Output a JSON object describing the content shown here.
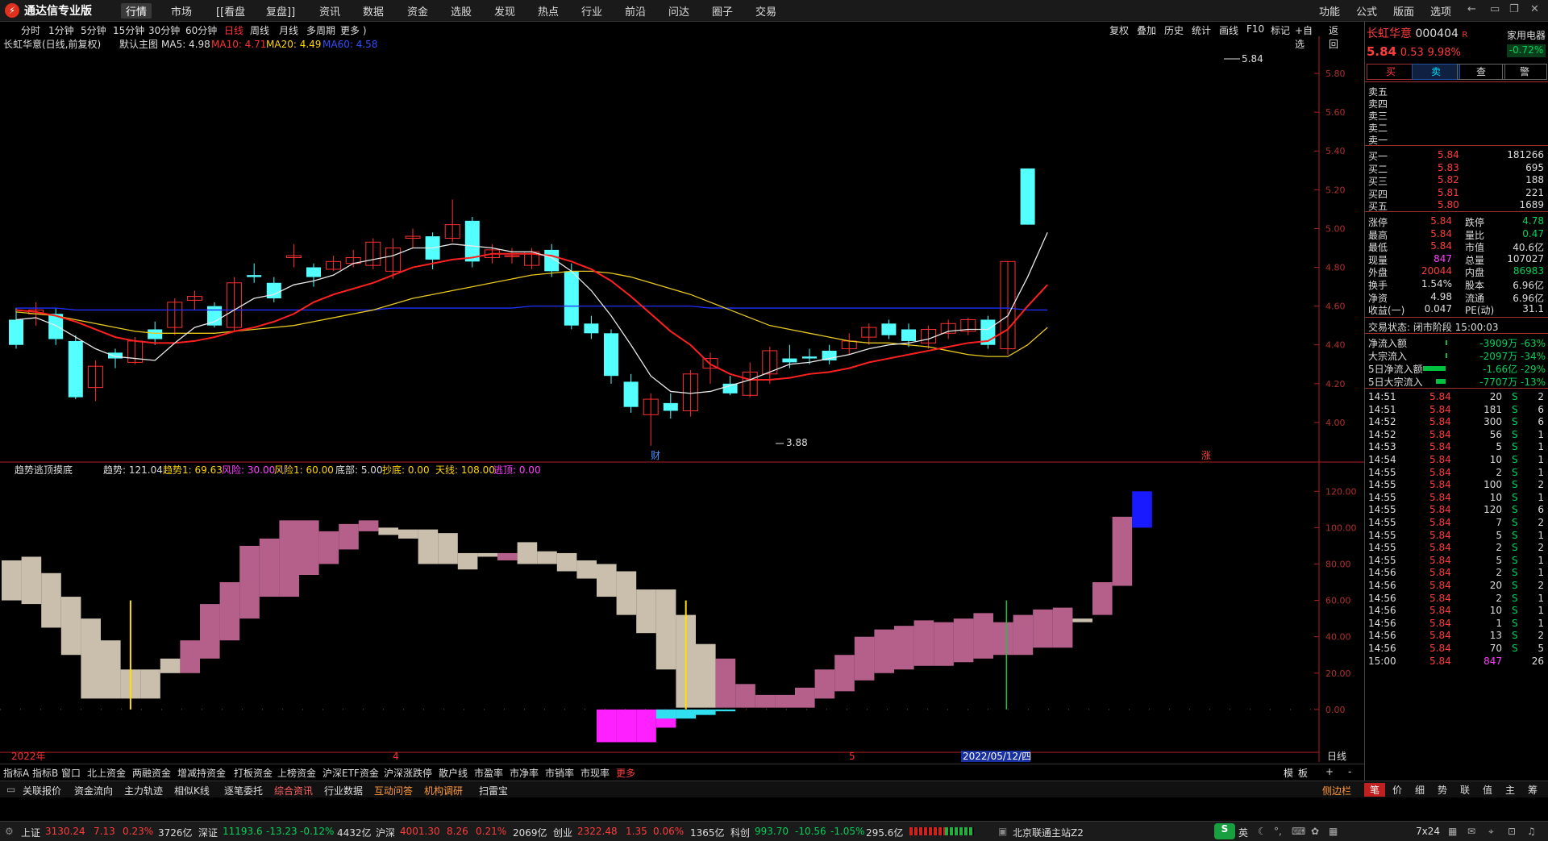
{
  "app": {
    "title": "通达信专业版",
    "logo_icon": "tdx-logo-icon"
  },
  "menu": [
    "行情",
    "市场",
    "[[看盘",
    "复盘]]",
    "资讯",
    "数据",
    "资金",
    "选股",
    "发现",
    "热点",
    "行业",
    "前沿",
    "问达",
    "圈子",
    "交易"
  ],
  "menu_right": [
    "功能",
    "公式",
    "版面",
    "选项"
  ],
  "periods": [
    "分时",
    "1分钟",
    "5分钟",
    "15分钟",
    "30分钟",
    "60分钟",
    "日线",
    "周线",
    "月线",
    "多周期",
    "更多 )"
  ],
  "active_period": "日线",
  "tools": [
    "复权",
    "叠加",
    "历史",
    "统计",
    "画线",
    "F10",
    "标记",
    "+自选",
    "返回"
  ],
  "main_chart": {
    "title": "长虹华意(日线,前复权)",
    "main_label": "默认主图",
    "ma5": "MA5: 4.98",
    "ma10": "MA10: 4.71",
    "ma20": "MA20: 4.49",
    "ma60": "MA60: 4.58",
    "high_mark": "5.84",
    "low_mark": "3.88",
    "cai_mark": "财",
    "zhang_mark": "涨"
  },
  "sub_chart": {
    "name": "趋势逃顶摸底",
    "trend": "趋势: 121.04",
    "trend1": "趋势1: 69.63",
    "risk": "风险: 30.00",
    "risk1": "风险1: 60.00",
    "bottom": "底部: 5.00",
    "buy_bottom": "抄底: 0.00",
    "sky": "天线: 108.00",
    "escape": "逃顶: 0.00"
  },
  "x_labels": [
    "2022年",
    "4",
    "5",
    "2022/05/12/四"
  ],
  "chart_data": [
    {
      "type": "candlestick",
      "y_ticks": [
        5.8,
        5.6,
        5.4,
        5.2,
        5.0,
        4.8,
        4.6,
        4.4,
        4.2,
        4.0
      ],
      "ylim": [
        3.85,
        5.9
      ],
      "candles": [
        [
          4.53,
          4.4,
          4.59,
          4.38
        ],
        [
          4.56,
          4.58,
          4.62,
          4.5
        ],
        [
          4.56,
          4.43,
          4.59,
          4.4
        ],
        [
          4.42,
          4.13,
          4.45,
          4.12
        ],
        [
          4.18,
          4.29,
          4.32,
          4.11
        ],
        [
          4.36,
          4.33,
          4.38,
          4.28
        ],
        [
          4.31,
          4.42,
          4.44,
          4.3
        ],
        [
          4.48,
          4.43,
          4.52,
          4.4
        ],
        [
          4.49,
          4.62,
          4.64,
          4.45
        ],
        [
          4.63,
          4.65,
          4.68,
          4.58
        ],
        [
          4.6,
          4.5,
          4.62,
          4.49
        ],
        [
          4.49,
          4.72,
          4.75,
          4.47
        ],
        [
          4.76,
          4.75,
          4.82,
          4.72
        ],
        [
          4.72,
          4.64,
          4.75,
          4.62
        ],
        [
          4.85,
          4.86,
          4.92,
          4.8
        ],
        [
          4.8,
          4.75,
          4.82,
          4.7
        ],
        [
          4.79,
          4.83,
          4.86,
          4.78
        ],
        [
          4.82,
          4.85,
          4.89,
          4.8
        ],
        [
          4.81,
          4.93,
          4.95,
          4.79
        ],
        [
          4.78,
          4.9,
          4.95,
          4.74
        ],
        [
          4.95,
          4.96,
          5.0,
          4.9
        ],
        [
          4.96,
          4.84,
          4.98,
          4.79
        ],
        [
          4.95,
          5.02,
          5.15,
          4.93
        ],
        [
          5.04,
          4.83,
          5.06,
          4.8
        ],
        [
          4.85,
          4.89,
          4.92,
          4.82
        ],
        [
          4.86,
          4.86,
          4.9,
          4.82
        ],
        [
          4.81,
          4.88,
          4.9,
          4.79
        ],
        [
          4.89,
          4.78,
          4.92,
          4.75
        ],
        [
          4.78,
          4.5,
          4.82,
          4.48
        ],
        [
          4.51,
          4.46,
          4.55,
          4.43
        ],
        [
          4.46,
          4.24,
          4.48,
          4.2
        ],
        [
          4.21,
          4.08,
          4.25,
          4.05
        ],
        [
          4.04,
          4.12,
          4.15,
          3.88
        ],
        [
          4.1,
          4.06,
          4.15,
          4.02
        ],
        [
          4.06,
          4.25,
          4.27,
          4.03
        ],
        [
          4.28,
          4.33,
          4.36,
          4.2
        ],
        [
          4.2,
          4.15,
          4.24,
          4.14
        ],
        [
          4.14,
          4.26,
          4.31,
          4.13
        ],
        [
          4.25,
          4.37,
          4.39,
          4.2
        ],
        [
          4.33,
          4.31,
          4.4,
          4.28
        ],
        [
          4.34,
          4.33,
          4.38,
          4.3
        ],
        [
          4.37,
          4.32,
          4.4,
          4.3
        ],
        [
          4.38,
          4.42,
          4.46,
          4.35
        ],
        [
          4.44,
          4.49,
          4.51,
          4.4
        ],
        [
          4.51,
          4.45,
          4.53,
          4.43
        ],
        [
          4.48,
          4.42,
          4.51,
          4.39
        ],
        [
          4.41,
          4.48,
          4.5,
          4.38
        ],
        [
          4.46,
          4.51,
          4.53,
          4.43
        ],
        [
          4.47,
          4.53,
          4.54,
          4.45
        ],
        [
          4.53,
          4.4,
          4.55,
          4.38
        ],
        [
          4.38,
          4.83,
          4.83,
          4.35
        ],
        [
          5.31,
          5.02,
          5.31,
          5.02
        ]
      ],
      "ma5": [
        4.53,
        4.54,
        4.5,
        4.44,
        4.38,
        4.34,
        4.33,
        4.32,
        4.41,
        4.49,
        4.52,
        4.58,
        4.64,
        4.66,
        4.71,
        4.73,
        4.76,
        4.82,
        4.84,
        4.86,
        4.9,
        4.9,
        4.92,
        4.91,
        4.9,
        4.88,
        4.88,
        4.85,
        4.78,
        4.68,
        4.55,
        4.4,
        4.24,
        4.16,
        4.15,
        4.16,
        4.19,
        4.22,
        4.26,
        4.3,
        4.31,
        4.33,
        4.35,
        4.38,
        4.4,
        4.41,
        4.43,
        4.47,
        4.48,
        4.48,
        4.55,
        4.75,
        4.98
      ],
      "ma10": [
        4.58,
        4.57,
        4.55,
        4.52,
        4.48,
        4.44,
        4.42,
        4.41,
        4.41,
        4.42,
        4.44,
        4.47,
        4.49,
        4.52,
        4.56,
        4.62,
        4.66,
        4.69,
        4.72,
        4.76,
        4.8,
        4.82,
        4.84,
        4.85,
        4.87,
        4.87,
        4.87,
        4.86,
        4.83,
        4.79,
        4.73,
        4.65,
        4.56,
        4.47,
        4.4,
        4.3,
        4.25,
        4.22,
        4.22,
        4.23,
        4.25,
        4.26,
        4.28,
        4.31,
        4.33,
        4.35,
        4.37,
        4.39,
        4.41,
        4.42,
        4.48,
        4.6,
        4.71
      ],
      "ma20": [
        4.57,
        4.56,
        4.55,
        4.53,
        4.51,
        4.49,
        4.47,
        4.46,
        4.46,
        4.46,
        4.46,
        4.47,
        4.48,
        4.49,
        4.5,
        4.52,
        4.54,
        4.56,
        4.58,
        4.61,
        4.64,
        4.66,
        4.68,
        4.7,
        4.72,
        4.74,
        4.76,
        4.77,
        4.78,
        4.78,
        4.77,
        4.75,
        4.72,
        4.69,
        4.66,
        4.62,
        4.58,
        4.54,
        4.5,
        4.48,
        4.46,
        4.44,
        4.42,
        4.41,
        4.41,
        4.4,
        4.39,
        4.37,
        4.35,
        4.34,
        4.34,
        4.4,
        4.49
      ],
      "ma60": [
        4.59,
        4.59,
        4.59,
        4.58,
        4.58,
        4.58,
        4.58,
        4.58,
        4.58,
        4.58,
        4.58,
        4.58,
        4.58,
        4.58,
        4.58,
        4.58,
        4.58,
        4.58,
        4.58,
        4.59,
        4.59,
        4.59,
        4.59,
        4.59,
        4.59,
        4.59,
        4.6,
        4.6,
        4.6,
        4.6,
        4.6,
        4.6,
        4.6,
        4.6,
        4.6,
        4.59,
        4.59,
        4.59,
        4.59,
        4.59,
        4.59,
        4.59,
        4.59,
        4.59,
        4.59,
        4.59,
        4.59,
        4.59,
        4.59,
        4.59,
        4.59,
        4.58,
        4.58
      ]
    },
    {
      "type": "bar",
      "y_ticks": [
        120.0,
        100.0,
        80.0,
        60.0,
        40.0,
        20.0,
        0.0
      ],
      "ylim": [
        -20,
        125
      ],
      "trend_bands": [
        [
          60,
          82
        ],
        [
          58,
          84
        ],
        [
          45,
          75
        ],
        [
          30,
          62
        ],
        [
          6,
          50
        ],
        [
          6,
          38
        ],
        [
          6,
          22
        ],
        [
          6,
          22
        ],
        [
          20,
          28
        ],
        [
          20,
          38
        ],
        [
          28,
          58
        ],
        [
          38,
          70
        ],
        [
          50,
          90
        ],
        [
          62,
          94
        ],
        [
          62,
          104
        ],
        [
          74,
          104
        ],
        [
          80,
          98
        ],
        [
          88,
          102
        ],
        [
          98,
          104
        ],
        [
          96,
          100
        ],
        [
          94,
          99
        ],
        [
          80,
          99
        ],
        [
          80,
          97
        ],
        [
          77,
          86
        ],
        [
          84,
          86
        ],
        [
          82,
          86
        ],
        [
          80,
          92
        ],
        [
          80,
          87
        ],
        [
          76,
          86
        ],
        [
          72,
          82
        ],
        [
          62,
          80
        ],
        [
          52,
          76
        ],
        [
          42,
          66
        ],
        [
          22,
          66
        ],
        [
          1,
          52
        ],
        [
          1,
          36
        ],
        [
          1,
          28
        ],
        [
          1,
          14
        ],
        [
          1,
          8
        ],
        [
          1,
          8
        ],
        [
          1,
          12
        ],
        [
          6,
          22
        ],
        [
          10,
          30
        ],
        [
          16,
          40
        ],
        [
          20,
          44
        ],
        [
          22,
          46
        ],
        [
          24,
          49
        ],
        [
          24,
          48
        ],
        [
          26,
          50
        ],
        [
          28,
          53
        ],
        [
          30,
          48
        ],
        [
          30,
          52
        ],
        [
          34,
          55
        ],
        [
          34,
          56
        ],
        [
          48,
          50
        ],
        [
          52,
          70
        ],
        [
          68,
          106
        ],
        [
          100,
          120
        ]
      ],
      "trend_colors": [
        "beige",
        "beige",
        "beige",
        "beige",
        "beige",
        "beige",
        "beige",
        "beige",
        "beige",
        "pink",
        "pink",
        "pink",
        "pink",
        "pink",
        "pink",
        "pink",
        "pink",
        "pink",
        "pink",
        "beige",
        "beige",
        "beige",
        "beige",
        "beige",
        "beige",
        "pink",
        "beige",
        "beige",
        "beige",
        "beige",
        "beige",
        "beige",
        "beige",
        "beige",
        "beige",
        "beige",
        "pink",
        "pink",
        "pink",
        "pink",
        "pink",
        "pink",
        "pink",
        "pink",
        "pink",
        "pink",
        "pink",
        "pink",
        "pink",
        "pink",
        "pink",
        "pink",
        "pink",
        "pink",
        "beige",
        "pink",
        "pink",
        "blue"
      ],
      "magenta_bars": [
        [
          30,
          -18
        ],
        [
          31,
          -18
        ],
        [
          32,
          -18
        ],
        [
          33,
          -10
        ]
      ],
      "cyan_bars": [
        [
          33,
          -5
        ],
        [
          34,
          -5
        ],
        [
          35,
          -3
        ],
        [
          36,
          -1
        ]
      ],
      "yellow_lines": [
        6,
        34
      ],
      "green_line": 50
    }
  ],
  "x_axis": {
    "label_period": "日线"
  },
  "quote": {
    "name": "长虹华意",
    "code": "000404",
    "flag": "R",
    "sector": "家用电器",
    "sector_chg": "-0.72%",
    "price": "5.84",
    "chg": "0.53",
    "pct": "9.98%",
    "buttons": [
      "买",
      "卖",
      "查",
      "警"
    ],
    "sell_levels": [
      "卖五",
      "卖四",
      "卖三",
      "卖二",
      "卖一"
    ],
    "buy_levels": [
      [
        "买一",
        "5.84",
        "181266"
      ],
      [
        "买二",
        "5.83",
        "695"
      ],
      [
        "买三",
        "5.82",
        "188"
      ],
      [
        "买四",
        "5.81",
        "221"
      ],
      [
        "买五",
        "5.80",
        "1689"
      ]
    ],
    "stats": [
      [
        "涨停",
        "5.84",
        "跌停",
        "4.78"
      ],
      [
        "最高",
        "5.84",
        "量比",
        "0.47"
      ],
      [
        "最低",
        "5.84",
        "市值",
        "40.6亿"
      ],
      [
        "现量",
        "847",
        "总量",
        "107027"
      ],
      [
        "外盘",
        "20044",
        "内盘",
        "86983"
      ],
      [
        "换手",
        "1.54%",
        "股本",
        "6.96亿"
      ],
      [
        "净资",
        "4.98",
        "流通",
        "6.96亿"
      ],
      [
        "收益(一)",
        "0.047",
        "PE(动)",
        "31.1"
      ]
    ],
    "trade_status": "交易状态: 闭市阶段 15:00:03",
    "flows": [
      [
        "净流入额",
        "-3909万 -63%"
      ],
      [
        "大宗流入",
        "-2097万 -34%"
      ],
      [
        "5日净流入额",
        "-1.66亿 -29%"
      ],
      [
        "5日大宗流入",
        "-7707万 -13%"
      ]
    ],
    "ticks": [
      [
        "14:51",
        "5.84",
        "20",
        "S",
        "2"
      ],
      [
        "14:51",
        "5.84",
        "181",
        "S",
        "6"
      ],
      [
        "14:52",
        "5.84",
        "300",
        "S",
        "6"
      ],
      [
        "14:52",
        "5.84",
        "56",
        "S",
        "1"
      ],
      [
        "14:53",
        "5.84",
        "5",
        "S",
        "1"
      ],
      [
        "14:54",
        "5.84",
        "10",
        "S",
        "1"
      ],
      [
        "14:55",
        "5.84",
        "2",
        "S",
        "1"
      ],
      [
        "14:55",
        "5.84",
        "100",
        "S",
        "2"
      ],
      [
        "14:55",
        "5.84",
        "10",
        "S",
        "1"
      ],
      [
        "14:55",
        "5.84",
        "120",
        "S",
        "6"
      ],
      [
        "14:55",
        "5.84",
        "7",
        "S",
        "2"
      ],
      [
        "14:55",
        "5.84",
        "5",
        "S",
        "1"
      ],
      [
        "14:55",
        "5.84",
        "2",
        "S",
        "2"
      ],
      [
        "14:55",
        "5.84",
        "5",
        "S",
        "1"
      ],
      [
        "14:56",
        "5.84",
        "2",
        "S",
        "1"
      ],
      [
        "14:56",
        "5.84",
        "20",
        "S",
        "2"
      ],
      [
        "14:56",
        "5.84",
        "2",
        "S",
        "1"
      ],
      [
        "14:56",
        "5.84",
        "10",
        "S",
        "1"
      ],
      [
        "14:56",
        "5.84",
        "1",
        "S",
        "1"
      ],
      [
        "14:56",
        "5.84",
        "13",
        "S",
        "2"
      ],
      [
        "14:56",
        "5.84",
        "70",
        "S",
        "5"
      ],
      [
        "15:00",
        "5.84",
        "847",
        "",
        "26"
      ]
    ],
    "bottom_tabs": [
      "笔",
      "价",
      "细",
      "势",
      "联",
      "值",
      "主",
      "筹"
    ]
  },
  "tabs1": [
    "指标A",
    "指标B",
    "窗口",
    "北上资金",
    "两融资金",
    "增减持资金",
    "打板资金",
    "上榜资金",
    "沪深ETF资金",
    "沪深涨跌停",
    "散户线",
    "市盈率",
    "市净率",
    "市销率",
    "市现率",
    "更多"
  ],
  "tabs1_right": [
    "模",
    "板",
    "+",
    "-"
  ],
  "tabs2": [
    "关联报价",
    "资金流向",
    "主力轨迹",
    "相似K线",
    "逐笔委托",
    "综合资讯",
    "行业数据",
    "互动问答",
    "机构调研",
    "扫雷宝"
  ],
  "tabs2_right": "侧边栏",
  "status": {
    "sh": [
      "上证",
      "3130.24",
      "7.13",
      "0.23%",
      "3726亿"
    ],
    "sz": [
      "深证",
      "11193.6",
      "-13.23",
      "-0.12%",
      "4432亿"
    ],
    "hs": [
      "沪深",
      "4001.30",
      "8.26",
      "0.21%",
      "2069亿"
    ],
    "cy": [
      "创业",
      "2322.48",
      "1.35",
      "0.06%",
      "1365亿"
    ],
    "kc": [
      "科创",
      "993.70",
      "-10.56",
      "-1.05%",
      "295.6亿"
    ],
    "server": "北京联通主站Z2",
    "ime": "英",
    "clock": "7x24"
  }
}
